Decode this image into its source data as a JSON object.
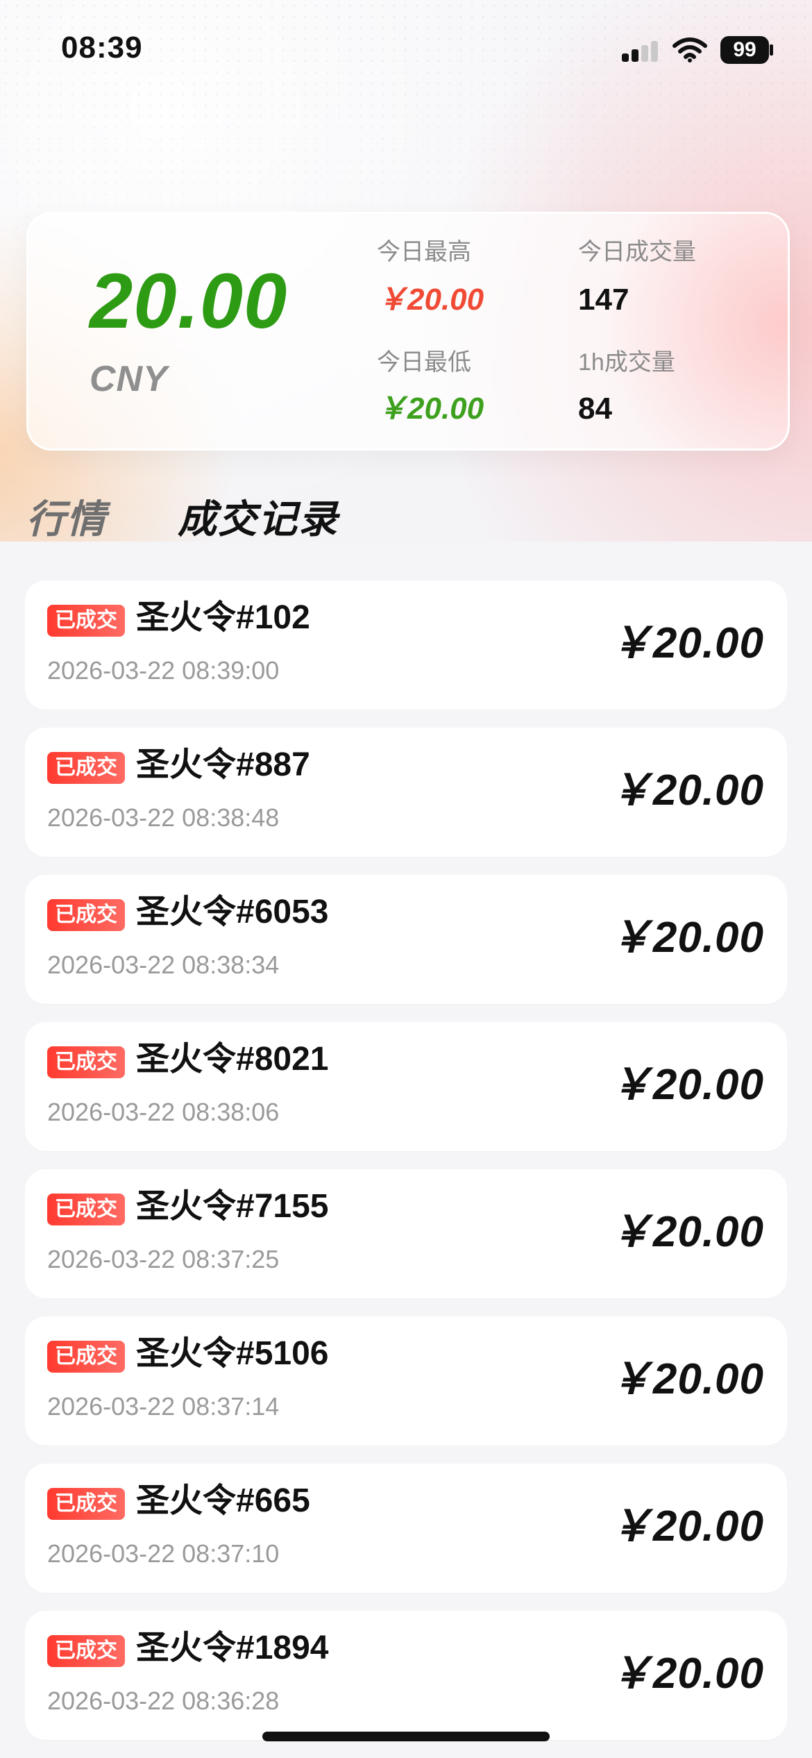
{
  "status_bar": {
    "time": "08:39",
    "signal_icon": "signal-icon",
    "wifi_icon": "wifi-icon",
    "battery_level": "99"
  },
  "summary": {
    "price": "20.00",
    "currency": "CNY",
    "today_high_label": "今日最高",
    "today_high_value": "￥20.00",
    "today_low_label": "今日最低",
    "today_low_value": "￥20.00",
    "today_volume_label": "今日成交量",
    "today_volume_value": "147",
    "hour_volume_label": "1h成交量",
    "hour_volume_value": "84",
    "colors": {
      "main_price": "#2e9b14",
      "high_value": "#f04a35",
      "low_value": "#3ea11e"
    }
  },
  "tabs": [
    {
      "label": "行情",
      "active": false
    },
    {
      "label": "成交记录",
      "active": true
    }
  ],
  "records": [
    {
      "badge": "已成交",
      "title": "圣火令#102",
      "time": "2026-03-22 08:39:00",
      "price": "￥20.00"
    },
    {
      "badge": "已成交",
      "title": "圣火令#887",
      "time": "2026-03-22 08:38:48",
      "price": "￥20.00"
    },
    {
      "badge": "已成交",
      "title": "圣火令#6053",
      "time": "2026-03-22 08:38:34",
      "price": "￥20.00"
    },
    {
      "badge": "已成交",
      "title": "圣火令#8021",
      "time": "2026-03-22 08:38:06",
      "price": "￥20.00"
    },
    {
      "badge": "已成交",
      "title": "圣火令#7155",
      "time": "2026-03-22 08:37:25",
      "price": "￥20.00"
    },
    {
      "badge": "已成交",
      "title": "圣火令#5106",
      "time": "2026-03-22 08:37:14",
      "price": "￥20.00"
    },
    {
      "badge": "已成交",
      "title": "圣火令#665",
      "time": "2026-03-22 08:37:10",
      "price": "￥20.00"
    },
    {
      "badge": "已成交",
      "title": "圣火令#1894",
      "time": "2026-03-22 08:36:28",
      "price": "￥20.00"
    }
  ]
}
